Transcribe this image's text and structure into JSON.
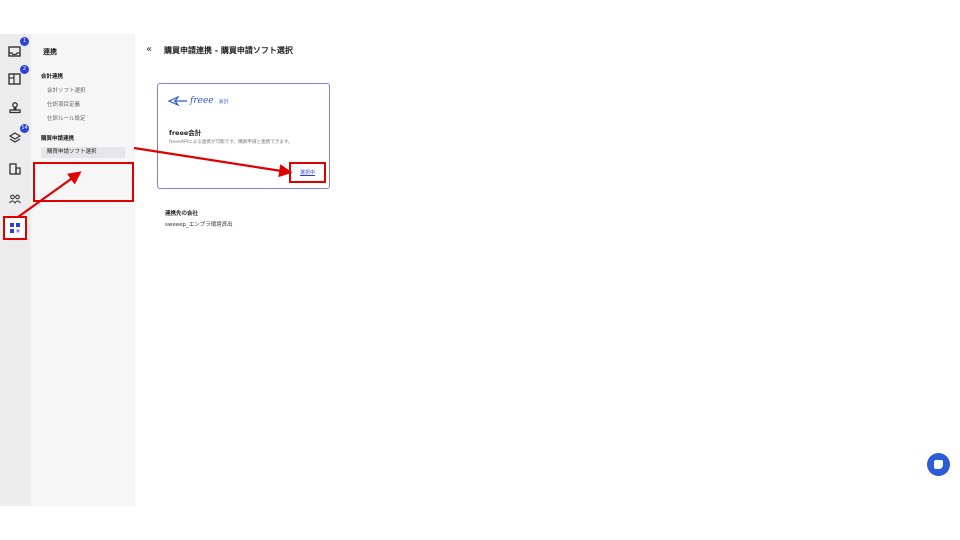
{
  "rail": {
    "items": [
      {
        "icon": "inbox-icon",
        "badge": "1"
      },
      {
        "icon": "panel-icon",
        "badge": "2"
      },
      {
        "icon": "stamp-icon",
        "badge": ""
      },
      {
        "icon": "layers-icon",
        "badge": "14"
      },
      {
        "icon": "building-icon",
        "badge": ""
      },
      {
        "icon": "users-icon",
        "badge": ""
      },
      {
        "icon": "apps-grid-icon",
        "badge": ""
      }
    ]
  },
  "subnav": {
    "title": "連携",
    "section1": {
      "label": "会計連携",
      "items": [
        "会計ソフト選択",
        "仕訳項目定義",
        "仕訳ルール設定"
      ]
    },
    "section2": {
      "label": "購買申請連携",
      "items": [
        "購買申請ソフト選択"
      ]
    }
  },
  "main": {
    "title": "購買申請連携 - 購買申請ソフト選択",
    "card": {
      "logo_text": "freee",
      "logo_sub": "会計",
      "name": "freee会計",
      "description": "freeeAPIによる連携が可能です。購買申請と連携できます。",
      "select_label": "選択中"
    },
    "linked_label": "連携先の会社",
    "linked_value": "sweeep_エンプラ環境資出"
  },
  "colors": {
    "accent": "#2c3fd6",
    "annotation": "#e00000"
  }
}
